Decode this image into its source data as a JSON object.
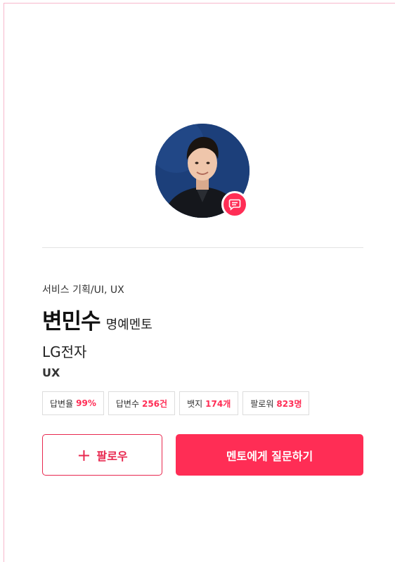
{
  "profile": {
    "category": "서비스 기획/UI, UX",
    "name": "변민수",
    "role": "명예멘토",
    "company": "LG전자",
    "field": "UX"
  },
  "stats": [
    {
      "label": "답변율",
      "value": "99%"
    },
    {
      "label": "답변수",
      "value": "256건"
    },
    {
      "label": "뱃지",
      "value": "174개"
    },
    {
      "label": "팔로워",
      "value": "823명"
    }
  ],
  "actions": {
    "follow_plus": "+",
    "follow_label": "팔로우",
    "ask_label": "멘토에게 질문하기"
  },
  "icons": {
    "avatar_badge": "chat-bubble-icon",
    "follow": "plus-icon"
  },
  "colors": {
    "accent": "#ff2d55",
    "avatar_background": "#1c3f7a"
  }
}
